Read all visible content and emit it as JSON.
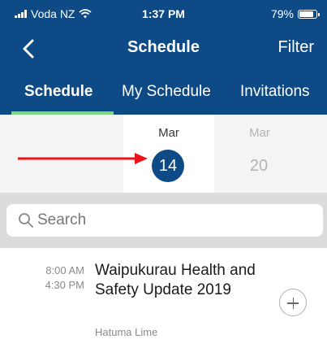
{
  "status_bar": {
    "carrier": "Voda NZ",
    "time": "1:37 PM",
    "battery": "79%",
    "battery_level": 0.79
  },
  "nav": {
    "title": "Schedule",
    "filter_label": "Filter",
    "back_icon": "chevron-left-icon"
  },
  "tabs": [
    {
      "label": "Schedule",
      "active": true
    },
    {
      "label": "My Schedule",
      "active": false
    },
    {
      "label": "Invitations",
      "active": false
    }
  ],
  "dates": [
    {
      "month": "Mar",
      "day": "14",
      "selected": true
    },
    {
      "month": "Mar",
      "day": "20",
      "selected": false
    }
  ],
  "annotation": {
    "arrow_color": "#e8141a"
  },
  "search": {
    "placeholder": "Search",
    "icon": "search-icon"
  },
  "events": [
    {
      "start": "8:00 AM",
      "end": "4:30 PM",
      "title": "Waipukurau Health and Safety Update 2019",
      "location": "Hatuma Lime"
    }
  ],
  "colors": {
    "header": "#0e4a86",
    "tab_underline": "#7ed67e",
    "selected_date": "#0e4a86"
  }
}
